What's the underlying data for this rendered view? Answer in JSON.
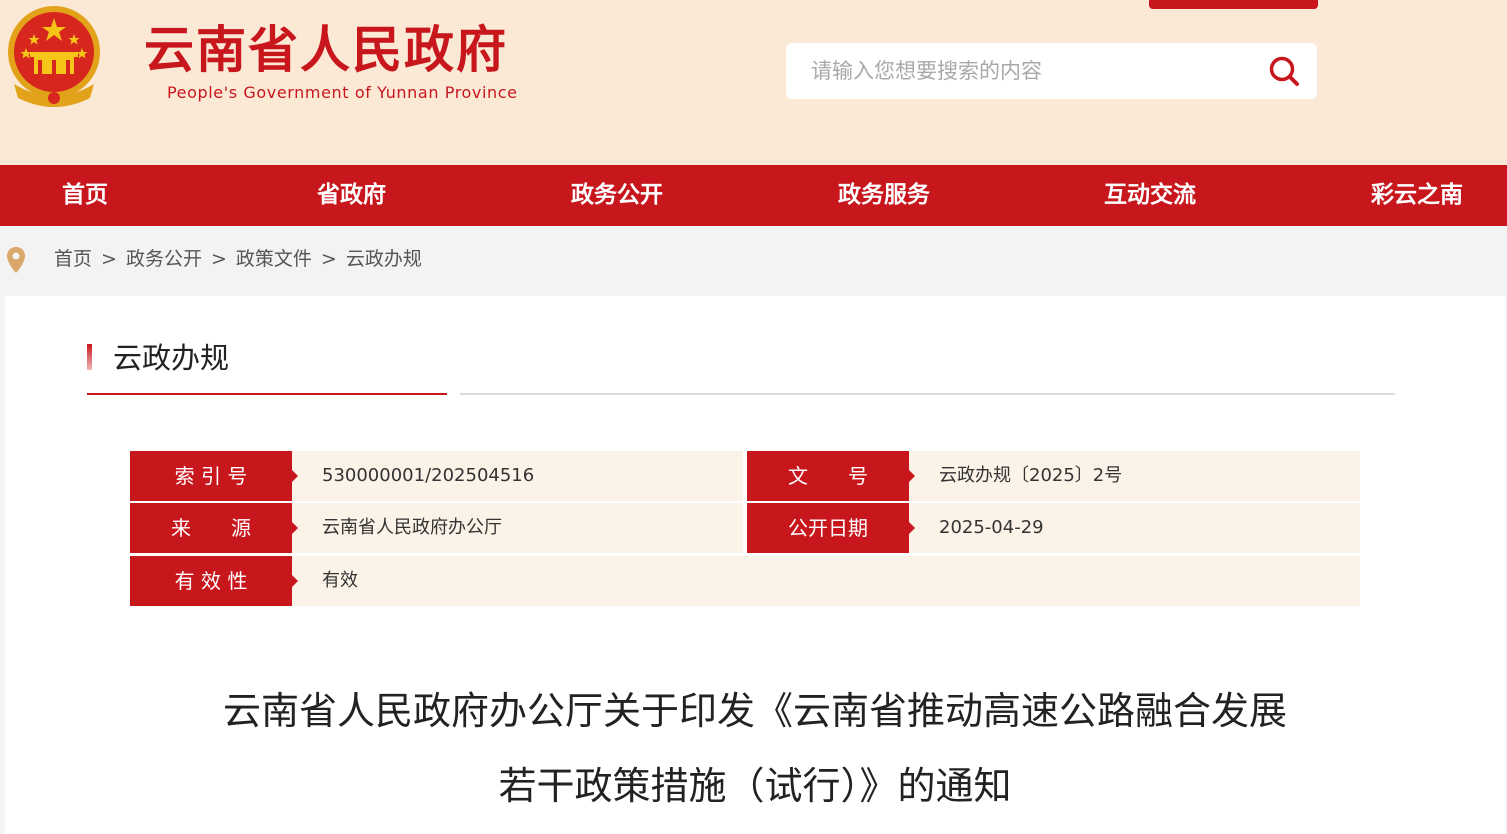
{
  "header": {
    "title": "云南省人民政府",
    "subtitle": "People's Government of Yunnan Province",
    "search_placeholder": "请输入您想要搜索的内容"
  },
  "nav": {
    "items": [
      "首页",
      "省政府",
      "政务公开",
      "政务服务",
      "互动交流",
      "彩云之南"
    ]
  },
  "breadcrumb": {
    "items": [
      "首页",
      "政务公开",
      "政策文件",
      "云政办规"
    ],
    "separator": ">"
  },
  "section": {
    "title": "云政办规"
  },
  "meta": {
    "index_label": "索 引 号",
    "index_value": "530000001/202504516",
    "docno_label": "文　　号",
    "docno_value": "云政办规〔2025〕2号",
    "source_label": "来　　源",
    "source_value": "云南省人民政府办公厅",
    "date_label": "公开日期",
    "date_value": "2025-04-29",
    "validity_label": "有 效 性",
    "validity_value": "有效"
  },
  "document": {
    "title_line1": "云南省人民政府办公厅关于印发《云南省推动高速公路融合发展",
    "title_line2": "若干政策措施（试行）》的通知"
  },
  "colors": {
    "brand_red": "#c8161d",
    "header_bg": "#fbe9d6",
    "meta_bg": "#fbf2e8",
    "emblem_gold": "#f5c518"
  }
}
